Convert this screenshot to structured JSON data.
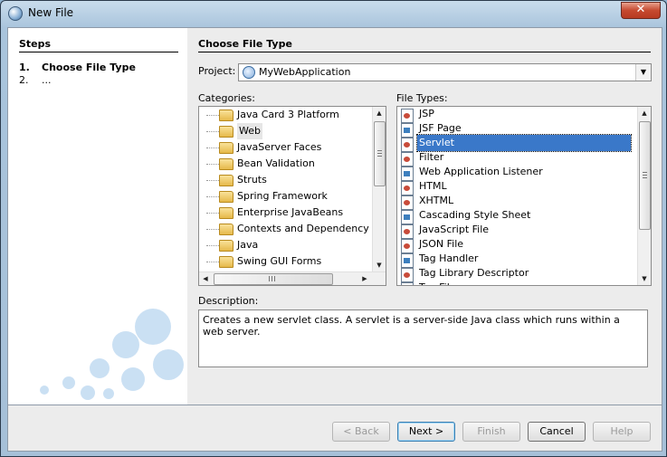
{
  "window": {
    "title": "New File",
    "close_glyph": "✕"
  },
  "steps": {
    "title": "Steps",
    "items": [
      {
        "num": "1.",
        "label": "Choose File Type",
        "current": true
      },
      {
        "num": "2.",
        "label": "...",
        "current": false
      }
    ]
  },
  "main": {
    "title": "Choose File Type",
    "project_label": "Project:",
    "project_value": "MyWebApplication",
    "categories_label": "Categories:",
    "file_types_label": "File Types:",
    "description_label": "Description:",
    "description_text": "Creates a new servlet class. A servlet is a server-side Java class which runs within a web server."
  },
  "categories": [
    {
      "label": "Java Card 3 Platform",
      "selected": false
    },
    {
      "label": "Web",
      "selected": true
    },
    {
      "label": "JavaServer Faces",
      "selected": false
    },
    {
      "label": "Bean Validation",
      "selected": false
    },
    {
      "label": "Struts",
      "selected": false
    },
    {
      "label": "Spring Framework",
      "selected": false
    },
    {
      "label": "Enterprise JavaBeans",
      "selected": false
    },
    {
      "label": "Contexts and Dependency Inje",
      "selected": false
    },
    {
      "label": "Java",
      "selected": false
    },
    {
      "label": "Swing GUI Forms",
      "selected": false
    }
  ],
  "file_types": [
    {
      "label": "JSP",
      "icon": "jsp-file-icon"
    },
    {
      "label": "JSF Page",
      "icon": "jsf-file-icon"
    },
    {
      "label": "Servlet",
      "icon": "servlet-file-icon",
      "selected": true
    },
    {
      "label": "Filter",
      "icon": "filter-file-icon"
    },
    {
      "label": "Web Application Listener",
      "icon": "listener-file-icon"
    },
    {
      "label": "HTML",
      "icon": "html-file-icon"
    },
    {
      "label": "XHTML",
      "icon": "xhtml-file-icon"
    },
    {
      "label": "Cascading Style Sheet",
      "icon": "css-file-icon"
    },
    {
      "label": "JavaScript File",
      "icon": "js-file-icon"
    },
    {
      "label": "JSON File",
      "icon": "json-file-icon"
    },
    {
      "label": "Tag Handler",
      "icon": "tag-handler-icon"
    },
    {
      "label": "Tag Library Descriptor",
      "icon": "tld-file-icon"
    },
    {
      "label": "Tag File",
      "icon": "tag-file-icon"
    }
  ],
  "buttons": {
    "back": "< Back",
    "next": "Next >",
    "finish": "Finish",
    "cancel": "Cancel",
    "help": "Help"
  },
  "colors": {
    "selection": "#3a78c9"
  }
}
